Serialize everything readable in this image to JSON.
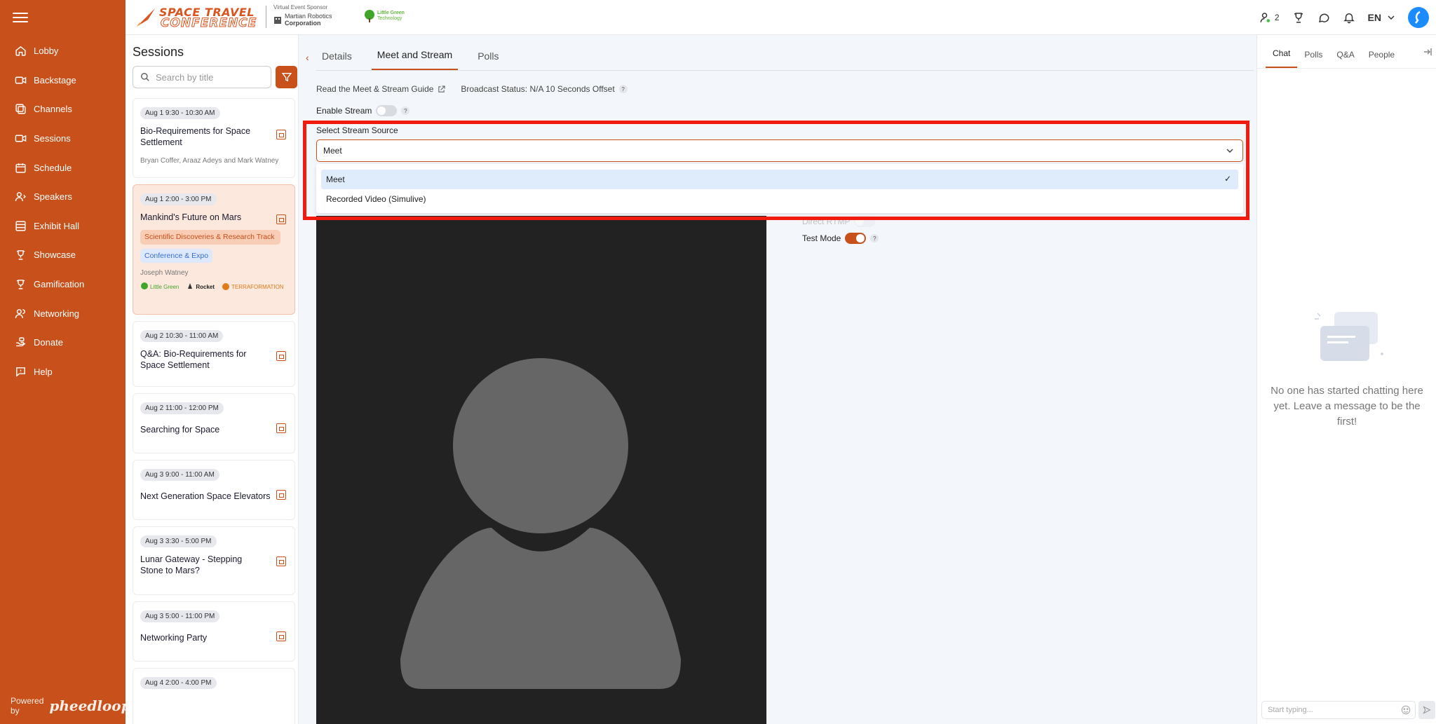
{
  "sidebar": {
    "items": [
      {
        "label": "Lobby",
        "icon": "home-icon"
      },
      {
        "label": "Backstage",
        "icon": "video-camera-icon"
      },
      {
        "label": "Channels",
        "icon": "channels-icon"
      },
      {
        "label": "Sessions",
        "icon": "sessions-icon"
      },
      {
        "label": "Schedule",
        "icon": "calendar-icon"
      },
      {
        "label": "Speakers",
        "icon": "speaker-icon"
      },
      {
        "label": "Exhibit Hall",
        "icon": "exhibit-icon"
      },
      {
        "label": "Showcase",
        "icon": "showcase-icon"
      },
      {
        "label": "Gamification",
        "icon": "trophy-icon"
      },
      {
        "label": "Networking",
        "icon": "networking-icon"
      },
      {
        "label": "Donate",
        "icon": "donate-icon"
      },
      {
        "label": "Help",
        "icon": "help-icon"
      }
    ],
    "powered_by": "Powered by",
    "brand": "pheedloop"
  },
  "header": {
    "logo_line1": "SPACE TRAVEL",
    "logo_line2": "CONFERENCE",
    "sponsor_label": "Virtual Event Sponsor",
    "sponsor_name_1": "Martian Robotics",
    "sponsor_name_2": "Corporation",
    "sponsor2_line1": "Little Green",
    "sponsor2_line2": "Technology",
    "attendee_count": "2",
    "language": "EN"
  },
  "sessions": {
    "title": "Sessions",
    "search_placeholder": "Search by title",
    "cards": [
      {
        "time": "Aug 1 9:30 - 10:30 AM",
        "title": "Bio-Requirements for Space Settlement",
        "speakers": "Bryan Coffer, Araaz Adeys and Mark Watney"
      },
      {
        "time": "Aug 1 2:00 - 3:00 PM",
        "title": "Mankind's Future on Mars",
        "tag1": "Scientific Discoveries & Research Track",
        "tag2": "Conference & Expo",
        "speakers": "Joseph Watney",
        "sponsors": [
          "Little Green",
          "Rocket",
          "TERRAFORMATION"
        ]
      },
      {
        "time": "Aug 2 10:30 - 11:00 AM",
        "title": "Q&A: Bio-Requirements for Space Settlement"
      },
      {
        "time": "Aug 2 11:00 - 12:00 PM",
        "title": "Searching for Space"
      },
      {
        "time": "Aug 3 9:00 - 11:00 AM",
        "title": "Next Generation Space Elevators"
      },
      {
        "time": "Aug 3 3:30 - 5:00 PM",
        "title": "Lunar Gateway - Stepping Stone to Mars?"
      },
      {
        "time": "Aug 3 5:00 - 11:00 PM",
        "title": "Networking Party"
      },
      {
        "time": "Aug 4 2:00 - 4:00 PM",
        "title": ""
      }
    ]
  },
  "main": {
    "tabs": [
      "Details",
      "Meet and Stream",
      "Polls"
    ],
    "guide_link": "Read the Meet & Stream Guide",
    "broadcast_status": "Broadcast Status: N/A 10 Seconds Offset",
    "enable_stream": "Enable Stream",
    "select_label": "Select Stream Source",
    "select_value": "Meet",
    "options": [
      "Meet",
      "Recorded Video (Simulive)"
    ],
    "direct_rtmp": "Direct RTMP",
    "test_mode": "Test Mode"
  },
  "right_panel": {
    "tabs": [
      "Chat",
      "Polls",
      "Q&A",
      "People"
    ],
    "empty_message": "No one has started chatting here yet. Leave a message to be the first!",
    "input_placeholder": "Start typing..."
  },
  "colors": {
    "brand": "#c8501a",
    "highlight": "#f01a0e",
    "selected_option": "#dfecfb"
  }
}
